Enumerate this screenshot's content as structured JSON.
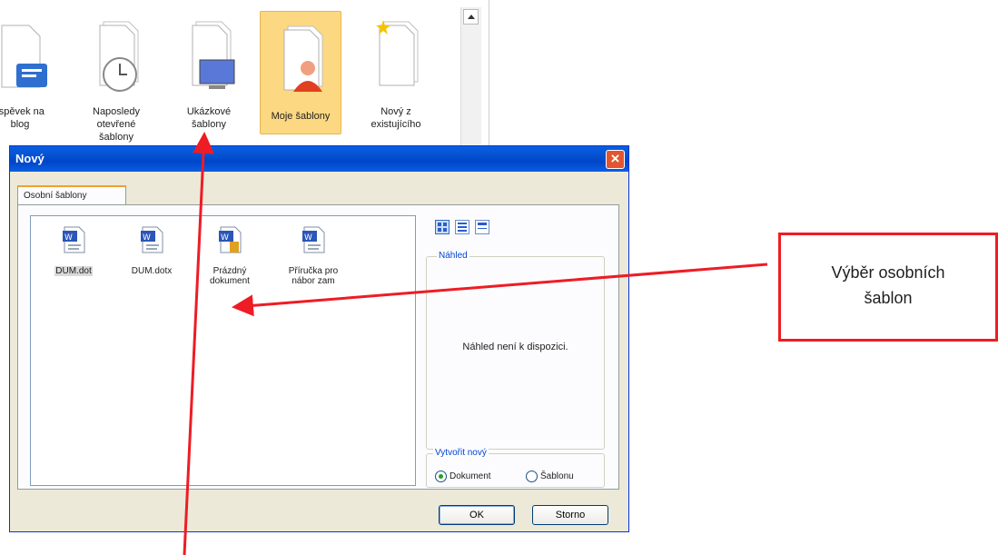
{
  "gallery": {
    "items": [
      {
        "label": "řspěvek na\nblog",
        "icon": "blog-post-icon"
      },
      {
        "label": "Naposledy\notevřené\nšablony",
        "icon": "recent-clock-icon"
      },
      {
        "label": "Ukázkové\nšablony",
        "icon": "sample-templates-icon"
      },
      {
        "label": "Moje šablony",
        "icon": "my-templates-person-icon",
        "selected": true
      },
      {
        "label": "Nový z\nexistujícího",
        "icon": "new-from-existing-icon"
      }
    ]
  },
  "dialog": {
    "title": "Nový",
    "tab_label": "Osobní šablony",
    "files": [
      {
        "label": "DUM.dot",
        "icon": "word-template-icon",
        "selected": true
      },
      {
        "label": "DUM.dotx",
        "icon": "word-template-icon"
      },
      {
        "label": "Prázdný\ndokument",
        "icon": "word-blank-document-icon"
      },
      {
        "label": "Příručka pro\nnábor zam",
        "icon": "word-template-icon"
      }
    ],
    "view_buttons": [
      "large-icons-view-icon",
      "list-view-icon",
      "details-view-icon"
    ],
    "preview_label": "Náhled",
    "preview_text": "Náhled není k dispozici.",
    "create_new_label": "Vytvořit nový",
    "radio_document": "Dokument",
    "radio_template": "Šablonu",
    "ok_label": "OK",
    "cancel_label": "Storno"
  },
  "annotation": {
    "callout_text": "Výběr osobních\nšablon",
    "arrow_color": "#ee1c25"
  }
}
